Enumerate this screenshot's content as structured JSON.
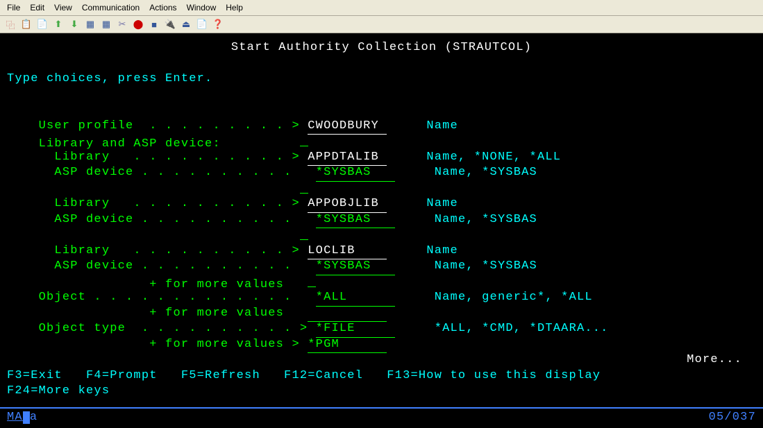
{
  "menu": {
    "file": "File",
    "edit": "Edit",
    "view": "View",
    "communication": "Communication",
    "actions": "Actions",
    "window": "Window",
    "help": "Help"
  },
  "screen": {
    "title": "Start Authority Collection (STRAUTCOL)",
    "instruction": "Type choices, press Enter.",
    "labels": {
      "user_profile": "User profile  . . . . . . . . .",
      "lib_asp": "Library and ASP device:",
      "library": "  Library   . . . . . . . . . .",
      "asp_device": "  ASP device . . . . . . . . . .",
      "more_values": "              + for more values",
      "object": "Object . . . . . . . . . . . . .",
      "object_type": "Object type  . . . . . . . . . ."
    },
    "values": {
      "user_profile": "CWOODBURY ",
      "lib1": "APPDTALIB ",
      "asp1": "*SYSBAS   ",
      "lib2": "APPOBJLIB ",
      "asp2": "*SYSBAS   ",
      "lib3": "LOCLIB    ",
      "asp3": "*SYSBAS   ",
      "object": "*ALL      ",
      "objtype1": "*FILE     ",
      "objtype2": "*PGM      "
    },
    "hints": {
      "name": "Name",
      "name_none_all": "Name, *NONE, *ALL",
      "name_sysbas": "Name, *SYSBAS",
      "name_gen_all": "Name, generic*, *ALL",
      "all_cmd": "*ALL, *CMD, *DTAARA..."
    },
    "more": "More...",
    "fkeys": {
      "line1": "F3=Exit   F4=Prompt   F5=Refresh   F12=Cancel   F13=How to use this display",
      "line2": "F24=More keys"
    }
  },
  "status": {
    "ma": "MA",
    "a": "a",
    "pos": "05/037"
  }
}
